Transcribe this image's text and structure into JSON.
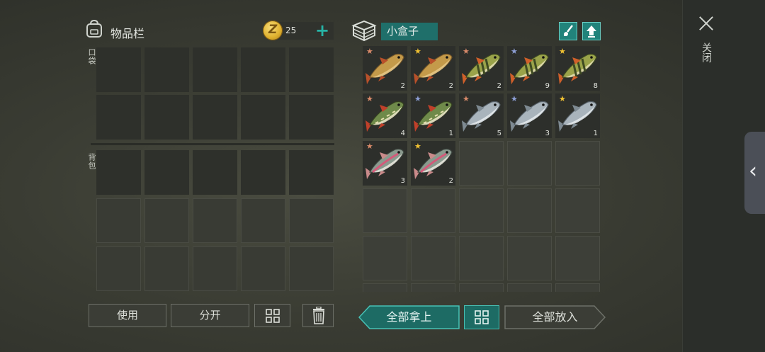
{
  "inventory": {
    "title": "物品栏",
    "coins": "25",
    "add_label": "+",
    "pocket_label": "口袋",
    "backpack_label": "背包"
  },
  "container": {
    "name": "小盒子"
  },
  "close": {
    "label": "关闭"
  },
  "side_tab": {
    "label": "‹"
  },
  "buttons": {
    "use": "使用",
    "split": "分开",
    "take_all": "全部拿上",
    "put_all": "全部放入"
  },
  "box_items": [
    {
      "fish": "carp",
      "star": "bronze",
      "qty": "2"
    },
    {
      "fish": "carp",
      "star": "gold",
      "qty": "2"
    },
    {
      "fish": "perch",
      "star": "bronze",
      "qty": "2"
    },
    {
      "fish": "perch",
      "star": "silver",
      "qty": "9"
    },
    {
      "fish": "perch",
      "star": "gold",
      "qty": "8"
    },
    {
      "fish": "pike",
      "star": "bronze",
      "qty": "4"
    },
    {
      "fish": "pike",
      "star": "silver",
      "qty": "1"
    },
    {
      "fish": "salmon",
      "star": "bronze",
      "qty": "5"
    },
    {
      "fish": "salmon",
      "star": "silver",
      "qty": "3"
    },
    {
      "fish": "salmon",
      "star": "gold",
      "qty": "1"
    },
    {
      "fish": "trout",
      "star": "bronze",
      "qty": "3"
    },
    {
      "fish": "trout",
      "star": "gold",
      "qty": "2"
    }
  ],
  "colors": {
    "accent": "#27b3a6",
    "bronze_star": "#d98a6a",
    "silver_star": "#8d9fd6",
    "gold_star": "#f1c232"
  }
}
